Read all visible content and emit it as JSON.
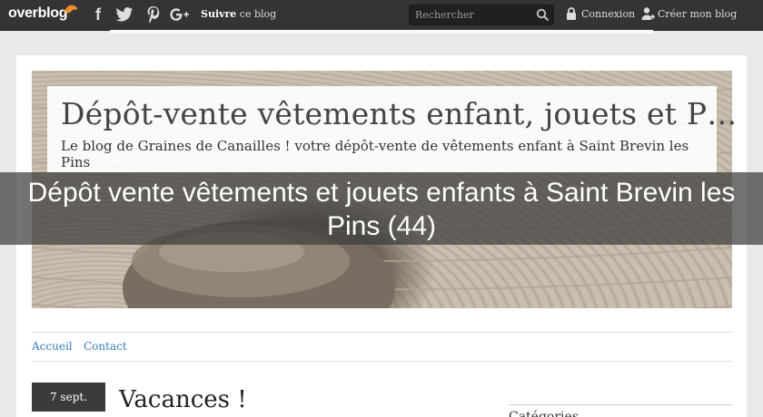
{
  "topbar": {
    "logo_text": "overblog",
    "social": [
      "facebook",
      "twitter",
      "pinterest",
      "google-plus"
    ],
    "follow_bold": "Suivre",
    "follow_rest": " ce blog",
    "search_placeholder": "Rechercher",
    "login_label": "Connexion",
    "create_label": "Créer mon blog"
  },
  "header": {
    "title": "Dépôt-vente vêtements enfant, jouets et P…",
    "description": "Le blog de Graines de Canailles ! votre dépôt-vente de vêtements enfant à Saint Brevin les Pins"
  },
  "overlay": {
    "text": "Dépôt vente vêtements et jouets enfants à  Saint Brevin les Pins (44)"
  },
  "nav": {
    "items": [
      "Accueil",
      "Contact"
    ]
  },
  "post": {
    "date": "7 sept.",
    "title": "Vacances !"
  },
  "sidebar": {
    "partial_heading": "Catégories"
  },
  "colors": {
    "topbar": "#343434",
    "link": "#3a7dbe",
    "date_badge": "#3b3b3b"
  }
}
